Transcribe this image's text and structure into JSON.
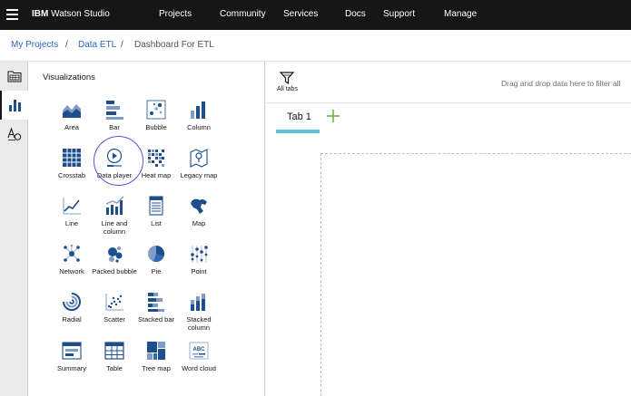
{
  "topnav": {
    "brand_strong": "IBM",
    "brand_rest": " Watson Studio",
    "items": [
      "Projects",
      "Community",
      "Services",
      "Docs",
      "Support",
      "Manage"
    ]
  },
  "breadcrumb": {
    "items": [
      "My Projects",
      "Data ETL",
      "Dashboard For ETL"
    ],
    "separator": "/"
  },
  "panel": {
    "title": "Visualizations",
    "items": [
      {
        "label": "Area",
        "icon": "area-chart-icon"
      },
      {
        "label": "Bar",
        "icon": "bar-chart-icon"
      },
      {
        "label": "Bubble",
        "icon": "bubble-chart-icon"
      },
      {
        "label": "Column",
        "icon": "column-chart-icon"
      },
      {
        "label": "Crosstab",
        "icon": "crosstab-icon"
      },
      {
        "label": "Data player",
        "icon": "data-player-icon"
      },
      {
        "label": "Heat map",
        "icon": "heat-map-icon"
      },
      {
        "label": "Legacy map",
        "icon": "legacy-map-icon"
      },
      {
        "label": "Line",
        "icon": "line-chart-icon"
      },
      {
        "label": "Line and column",
        "icon": "line-and-column-icon"
      },
      {
        "label": "List",
        "icon": "list-icon"
      },
      {
        "label": "Map",
        "icon": "map-icon"
      },
      {
        "label": "Network",
        "icon": "network-icon"
      },
      {
        "label": "Packed bubble",
        "icon": "packed-bubble-icon"
      },
      {
        "label": "Pie",
        "icon": "pie-chart-icon"
      },
      {
        "label": "Point",
        "icon": "point-chart-icon"
      },
      {
        "label": "Radial",
        "icon": "radial-chart-icon"
      },
      {
        "label": "Scatter",
        "icon": "scatter-chart-icon"
      },
      {
        "label": "Stacked bar",
        "icon": "stacked-bar-icon"
      },
      {
        "label": "Stacked column",
        "icon": "stacked-column-icon"
      },
      {
        "label": "Summary",
        "icon": "summary-icon"
      },
      {
        "label": "Table",
        "icon": "table-icon"
      },
      {
        "label": "Tree map",
        "icon": "tree-map-icon"
      },
      {
        "label": "Word cloud",
        "icon": "word-cloud-icon"
      }
    ],
    "word_cloud_text": "ABC"
  },
  "canvas": {
    "filter_label": "All tabs",
    "drop_hint": "Drag and drop data here to filter all",
    "tab_label": "Tab 1"
  },
  "colors": {
    "accent": "#2b62c8",
    "icon_blue": "#1f4e8c",
    "tab_underline": "#5fc4cf",
    "add_tab": "#6ab84a",
    "highlight_circle": "#5b50e0"
  }
}
